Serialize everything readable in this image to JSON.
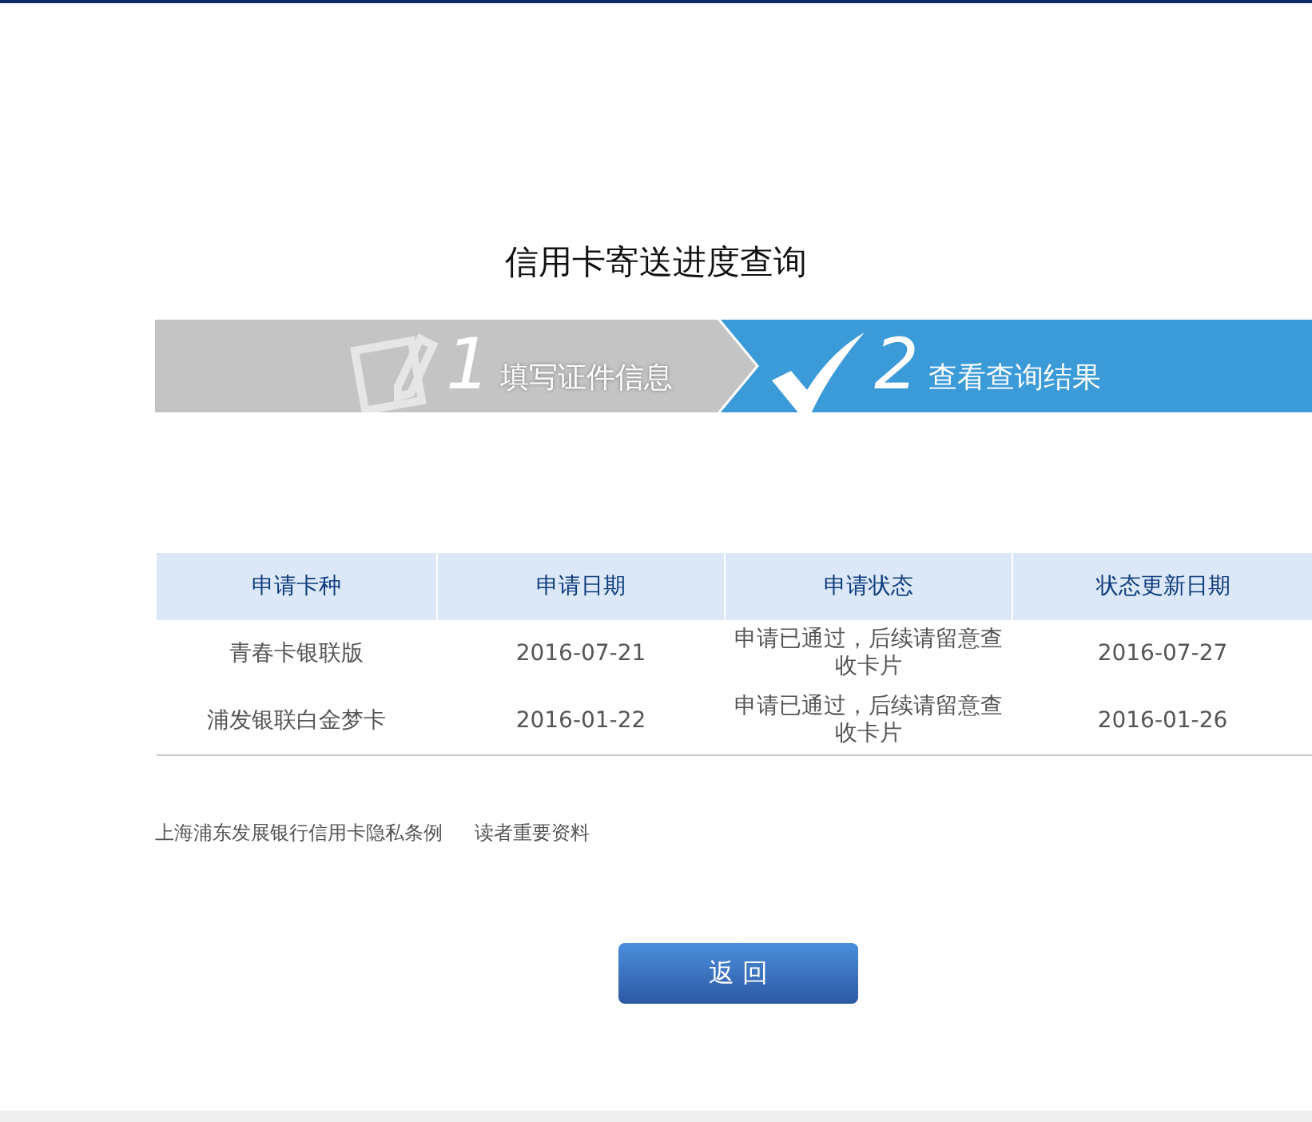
{
  "title": "信用卡寄送进度查询",
  "steps": [
    {
      "kind": "form",
      "number": "1",
      "label": "填写证件信息",
      "selected": false
    },
    {
      "kind": "result",
      "number": "2",
      "label": "查看查询结果",
      "selected": true
    }
  ],
  "table": {
    "columns": [
      "申请卡种",
      "申请日期",
      "申请状态",
      "状态更新日期"
    ],
    "rows": [
      [
        "青春卡银联版",
        "2016-07-21",
        "申请已通过，后续请留意查收卡片",
        "2016-07-27"
      ],
      [
        "浦发银联白金梦卡",
        "2016-01-22",
        "申请已通过，后续请留意查收卡片",
        "2016-01-26"
      ]
    ]
  },
  "links": [
    "上海浦东发展银行信用卡隐私条例",
    "读者重要资料"
  ],
  "back_button": "返 回"
}
